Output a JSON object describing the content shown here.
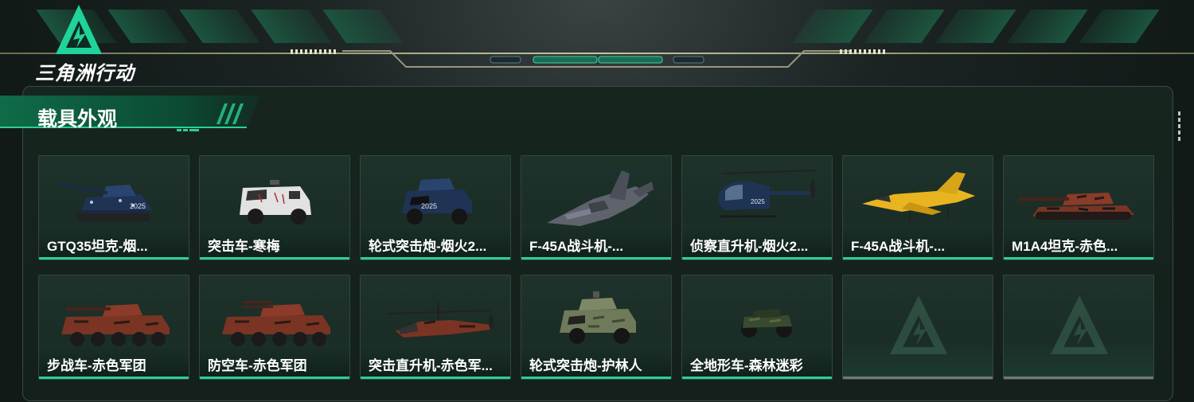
{
  "brand": {
    "logo_text": "三角洲行动",
    "accent": "#2ad193"
  },
  "panel": {
    "title": "载具外观"
  },
  "cards": [
    {
      "label": "GTQ35坦克-烟...",
      "icon": "tank-icon",
      "camo": "#1f3354"
    },
    {
      "label": "突击车-寒梅",
      "icon": "assault-vehicle-icon",
      "camo": "#d9d9d9"
    },
    {
      "label": "轮式突击炮-烟火2...",
      "icon": "wheeled-assault-gun-icon",
      "camo": "#1f3354"
    },
    {
      "label": "F-45A战斗机-...",
      "icon": "fighter-jet-icon",
      "camo": "#5a5e66"
    },
    {
      "label": "侦察直升机-烟火2...",
      "icon": "recon-helicopter-icon",
      "camo": "#1f3354"
    },
    {
      "label": "F-45A战斗机-...",
      "icon": "fighter-jet-icon",
      "camo": "#e8b420"
    },
    {
      "label": "M1A4坦克-赤色...",
      "icon": "tank-icon",
      "camo": "#7a3424"
    },
    {
      "label": "步战车-赤色军团",
      "icon": "ifv-icon",
      "camo": "#7a3424"
    },
    {
      "label": "防空车-赤色军团",
      "icon": "aa-vehicle-icon",
      "camo": "#7a3424"
    },
    {
      "label": "突击直升机-赤色军...",
      "icon": "attack-helicopter-icon",
      "camo": "#7a3424"
    },
    {
      "label": "轮式突击炮-护林人",
      "icon": "wheeled-assault-gun-icon",
      "camo": "#6f7a5a"
    },
    {
      "label": "全地形车-森林迷彩",
      "icon": "atv-icon",
      "camo": "#3a4a30"
    },
    {
      "label": "",
      "icon": "empty-slot-icon",
      "camo": ""
    },
    {
      "label": "",
      "icon": "empty-slot-icon",
      "camo": ""
    }
  ]
}
